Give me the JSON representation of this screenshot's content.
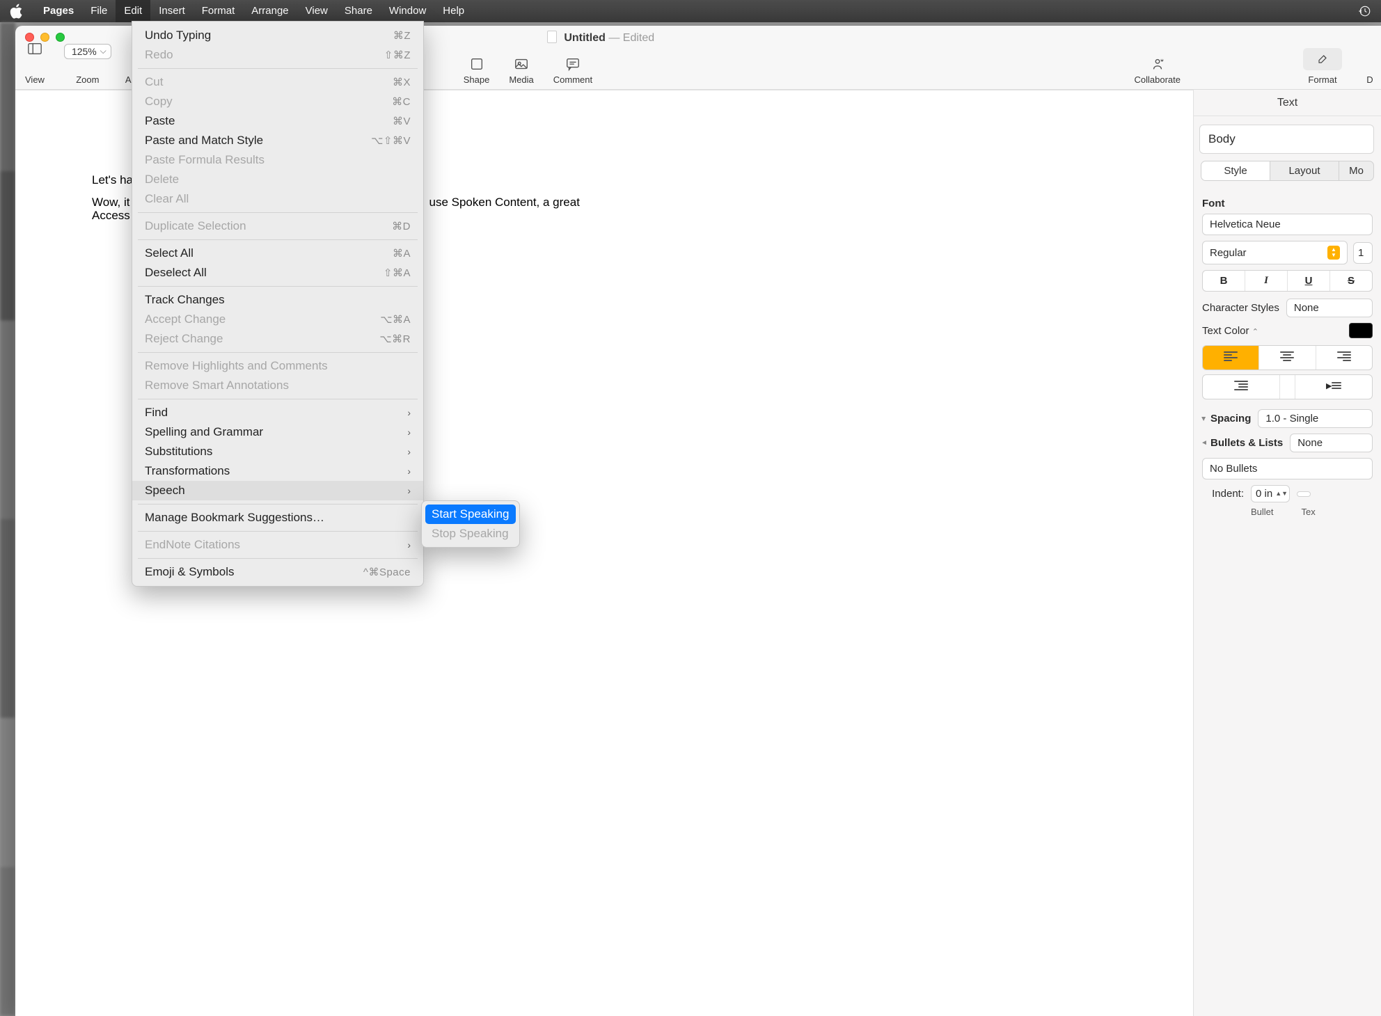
{
  "menubar": {
    "app": "Pages",
    "items": [
      "File",
      "Edit",
      "Insert",
      "Format",
      "Arrange",
      "View",
      "Share",
      "Window",
      "Help"
    ],
    "active": "Edit"
  },
  "window": {
    "title": "Untitled",
    "status": "Edited"
  },
  "toolbar": {
    "view": "View",
    "zoom_value": "125%",
    "zoom_label": "Zoom",
    "add_truncated": "Ad",
    "shape": "Shape",
    "media": "Media",
    "comment": "Comment",
    "collaborate": "Collaborate",
    "format": "Format",
    "doc_truncated": "D"
  },
  "document": {
    "p1": "Let's ha",
    "p2a": "Wow, it",
    "p2b": "use Spoken Content, a great",
    "p3": "Access"
  },
  "inspector": {
    "tab": "Text",
    "para_style": "Body",
    "segs": [
      "Style",
      "Layout",
      "Mo"
    ],
    "font_label": "Font",
    "font_family": "Helvetica Neue",
    "font_style": "Regular",
    "font_size_trunc": "1",
    "char_styles_label": "Character Styles",
    "char_styles_value": "None",
    "text_color_label": "Text Color",
    "spacing_label": "Spacing",
    "spacing_value": "1.0 - Single",
    "bullets_label": "Bullets & Lists",
    "bullets_value": "None",
    "bullets_style": "No Bullets",
    "indent_label": "Indent:",
    "indent_value": "0 in",
    "bullet_sub": "Bullet",
    "text_sub": "Tex"
  },
  "edit_menu": {
    "undo": {
      "label": "Undo Typing",
      "sc": "⌘Z"
    },
    "redo": {
      "label": "Redo",
      "sc": "⇧⌘Z"
    },
    "cut": {
      "label": "Cut",
      "sc": "⌘X"
    },
    "copy": {
      "label": "Copy",
      "sc": "⌘C"
    },
    "paste": {
      "label": "Paste",
      "sc": "⌘V"
    },
    "paste_match": {
      "label": "Paste and Match Style",
      "sc": "⌥⇧⌘V"
    },
    "paste_formula": {
      "label": "Paste Formula Results"
    },
    "delete": {
      "label": "Delete"
    },
    "clear_all": {
      "label": "Clear All"
    },
    "dup_sel": {
      "label": "Duplicate Selection",
      "sc": "⌘D"
    },
    "select_all": {
      "label": "Select All",
      "sc": "⌘A"
    },
    "deselect_all": {
      "label": "Deselect All",
      "sc": "⇧⌘A"
    },
    "track_changes": {
      "label": "Track Changes"
    },
    "accept_change": {
      "label": "Accept Change",
      "sc": "⌥⌘A"
    },
    "reject_change": {
      "label": "Reject Change",
      "sc": "⌥⌘R"
    },
    "remove_highlights": {
      "label": "Remove Highlights and Comments"
    },
    "remove_smart": {
      "label": "Remove Smart Annotations"
    },
    "find": {
      "label": "Find"
    },
    "spelling": {
      "label": "Spelling and Grammar"
    },
    "substitutions": {
      "label": "Substitutions"
    },
    "transformations": {
      "label": "Transformations"
    },
    "speech": {
      "label": "Speech"
    },
    "bookmarks": {
      "label": "Manage Bookmark Suggestions…"
    },
    "endnote": {
      "label": "EndNote Citations"
    },
    "emoji": {
      "label": "Emoji & Symbols",
      "sc": "^⌘Space"
    }
  },
  "speech_submenu": {
    "start": "Start Speaking",
    "stop": "Stop Speaking"
  }
}
